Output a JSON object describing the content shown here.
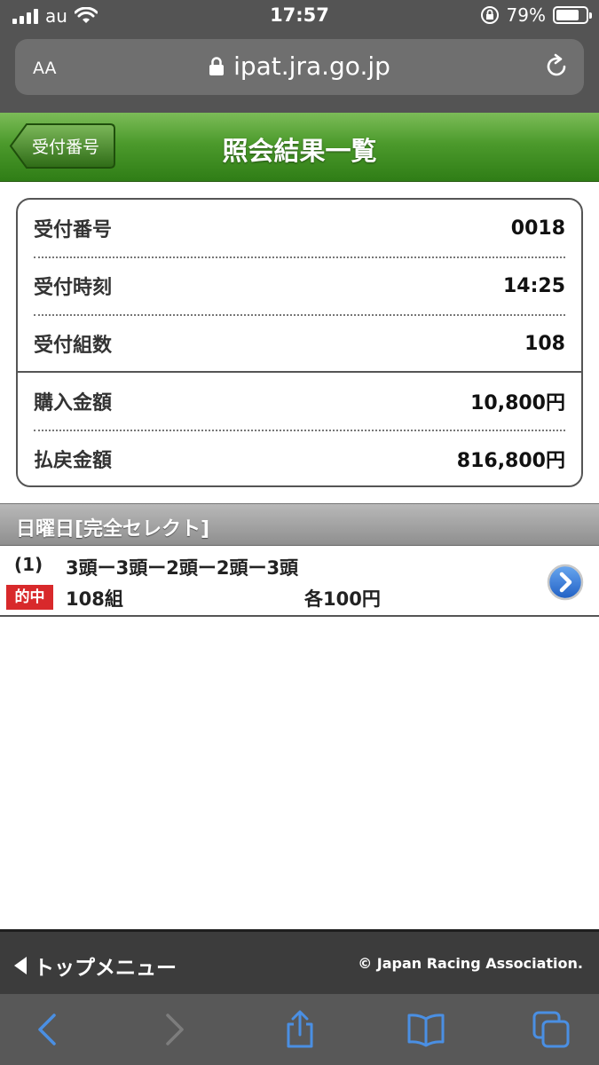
{
  "status_bar": {
    "carrier": "au",
    "time": "17:57",
    "battery_percent": "79%",
    "battery_level": 0.79,
    "icons": [
      "signal-icon",
      "wifi-icon",
      "orientation-lock-icon",
      "battery-icon"
    ]
  },
  "browser": {
    "text_size_label": "AA",
    "url": "ipat.jra.go.jp",
    "icons": [
      "padlock-icon",
      "reload-icon"
    ]
  },
  "header": {
    "back_label": "受付番号",
    "title": "照会結果一覧"
  },
  "summary": {
    "rows": [
      {
        "label": "受付番号",
        "value": "0018"
      },
      {
        "label": "受付時刻",
        "value": "14:25"
      },
      {
        "label": "受付組数",
        "value": "108"
      },
      {
        "label": "購入金額",
        "value": "10,800円"
      },
      {
        "label": "払戻金額",
        "value": "816,800円"
      }
    ]
  },
  "section": {
    "title": "日曜日[完全セレクト]"
  },
  "bets": [
    {
      "index": "(1)",
      "combination": "3頭ー3頭ー2頭ー2頭ー3頭",
      "badge": "的中",
      "count": "108組",
      "unit": "各100円"
    }
  ],
  "footer": {
    "top_menu_label": "トップメニュー",
    "copyright": "© Japan Racing Association."
  },
  "toolbar": {
    "icons": [
      "back-icon",
      "forward-icon",
      "share-icon",
      "bookmarks-icon",
      "tabs-icon"
    ]
  },
  "colors": {
    "header_green": "#4c9a2c",
    "hit_red": "#d8292b",
    "toolbar_blue": "#4a8fe3",
    "chrome_gray": "#545454"
  }
}
